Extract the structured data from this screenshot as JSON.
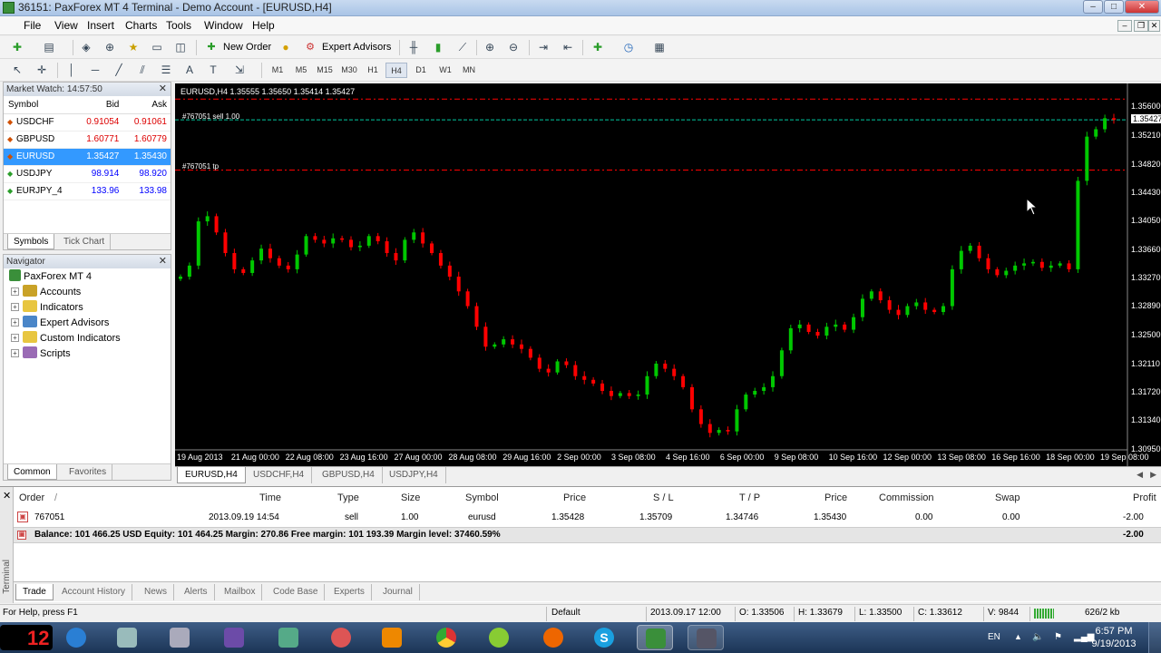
{
  "window": {
    "title": "36151: PaxForex MT 4 Terminal - Demo Account - [EURUSD,H4]"
  },
  "menu": [
    "File",
    "View",
    "Insert",
    "Charts",
    "Tools",
    "Window",
    "Help"
  ],
  "toolbar": {
    "new_order": "New Order",
    "expert_advisors": "Expert Advisors",
    "timeframes": [
      "M1",
      "M5",
      "M15",
      "M30",
      "H1",
      "H4",
      "D1",
      "W1",
      "MN"
    ],
    "active_timeframe": "H4"
  },
  "market_watch": {
    "title": "Market Watch: 14:57:50",
    "columns": [
      "Symbol",
      "Bid",
      "Ask"
    ],
    "rows": [
      {
        "symbol": "USDCHF",
        "bid": "0.91054",
        "ask": "0.91061",
        "dir": "down"
      },
      {
        "symbol": "GBPUSD",
        "bid": "1.60771",
        "ask": "1.60779",
        "dir": "down"
      },
      {
        "symbol": "EURUSD",
        "bid": "1.35427",
        "ask": "1.35430",
        "dir": "down",
        "selected": true
      },
      {
        "symbol": "USDJPY",
        "bid": "98.914",
        "ask": "98.920",
        "dir": "up"
      },
      {
        "symbol": "EURJPY_4",
        "bid": "133.96",
        "ask": "133.98",
        "dir": "up"
      }
    ],
    "tabs": [
      "Symbols",
      "Tick Chart"
    ]
  },
  "navigator": {
    "title": "Navigator",
    "root": "PaxForex MT 4",
    "items": [
      "Accounts",
      "Indicators",
      "Expert Advisors",
      "Custom Indicators",
      "Scripts"
    ],
    "tabs": [
      "Common",
      "Favorites"
    ]
  },
  "chart": {
    "info": "EURUSD,H4  1.35555 1.35650 1.35414 1.35427",
    "order_sell_label": "#767051 sell 1.00",
    "order_tp_label": "#767051 tp",
    "current_price": "1.35427",
    "cursor_icon": "arrow-cursor-icon",
    "tabs": [
      "EURUSD,H4",
      "USDCHF,H4",
      "GBPUSD,H4",
      "USDJPY,H4"
    ],
    "active_tab": "EURUSD,H4"
  },
  "chart_data": {
    "type": "candlestick",
    "symbol": "EURUSD",
    "timeframe": "H4",
    "ylim": [
      1.3095,
      1.357
    ],
    "y_ticks": [
      "1.35600",
      "1.35427",
      "1.35210",
      "1.34820",
      "1.34430",
      "1.34050",
      "1.33660",
      "1.33270",
      "1.32890",
      "1.32500",
      "1.32110",
      "1.31720",
      "1.31340",
      "1.30950"
    ],
    "x_ticks": [
      "19 Aug 2013",
      "21 Aug 00:00",
      "22 Aug 08:00",
      "23 Aug 16:00",
      "27 Aug 00:00",
      "28 Aug 08:00",
      "29 Aug 16:00",
      "2 Sep 00:00",
      "3 Sep 08:00",
      "4 Sep 16:00",
      "6 Sep 00:00",
      "9 Sep 08:00",
      "10 Sep 16:00",
      "12 Sep 00:00",
      "13 Sep 08:00",
      "16 Sep 16:00",
      "18 Sep 00:00",
      "19 Sep 08:00"
    ],
    "close_path": [
      1.333,
      1.3345,
      1.3405,
      1.3412,
      1.339,
      1.3362,
      1.334,
      1.3335,
      1.3352,
      1.3368,
      1.3355,
      1.3345,
      1.334,
      1.336,
      1.3385,
      1.338,
      1.3375,
      1.3382,
      1.338,
      1.337,
      1.3372,
      1.3385,
      1.3378,
      1.3362,
      1.3352,
      1.338,
      1.339,
      1.3375,
      1.3362,
      1.3345,
      1.333,
      1.331,
      1.329,
      1.3262,
      1.3235,
      1.3238,
      1.3245,
      1.3238,
      1.3232,
      1.322,
      1.3205,
      1.32,
      1.3215,
      1.321,
      1.3195,
      1.319,
      1.3185,
      1.3175,
      1.3168,
      1.3172,
      1.3168,
      1.317,
      1.3195,
      1.3212,
      1.3205,
      1.3195,
      1.318,
      1.315,
      1.313,
      1.3118,
      1.3122,
      1.312,
      1.315,
      1.317,
      1.3175,
      1.318,
      1.3195,
      1.323,
      1.326,
      1.3265,
      1.3255,
      1.325,
      1.3262,
      1.3265,
      1.3258,
      1.3275,
      1.33,
      1.331,
      1.3298,
      1.3285,
      1.3278,
      1.329,
      1.3295,
      1.3285,
      1.3282,
      1.329,
      1.334,
      1.3365,
      1.3372,
      1.3355,
      1.334,
      1.3332,
      1.3338,
      1.3345,
      1.3348,
      1.335,
      1.3342,
      1.3345,
      1.3348,
      1.334,
      1.346,
      1.352,
      1.353,
      1.3545,
      1.3543
    ],
    "open_order": {
      "id": "767051",
      "type": "sell",
      "price": 1.35428,
      "sl": 1.35709,
      "tp": 1.34746
    }
  },
  "terminal": {
    "side_label": "Terminal",
    "columns": [
      "Order",
      "/",
      "Time",
      "Type",
      "Size",
      "Symbol",
      "Price",
      "S / L",
      "T / P",
      "Price",
      "Commission",
      "Swap",
      "Profit"
    ],
    "order": {
      "order": "767051",
      "time": "2013.09.19 14:54",
      "type": "sell",
      "size": "1.00",
      "symbol": "eurusd",
      "price": "1.35428",
      "sl": "1.35709",
      "tp": "1.34746",
      "price_current": "1.35430",
      "commission": "0.00",
      "swap": "0.00",
      "profit": "-2.00"
    },
    "balance_line": "Balance: 101 466.25 USD  Equity: 101 464.25  Margin: 270.86  Free margin: 101 193.39  Margin level: 37460.59%",
    "balance_profit": "-2.00",
    "tabs": [
      "Trade",
      "Account History",
      "News",
      "Alerts",
      "Mailbox",
      "Code Base",
      "Experts",
      "Journal"
    ],
    "active_tab": "Trade"
  },
  "statusbar": {
    "help": "For Help, press F1",
    "profile": "Default",
    "datetime": "2013.09.17 12:00",
    "open": "O: 1.33506",
    "high": "H: 1.33679",
    "low": "L: 1.33500",
    "close": "C: 1.33612",
    "volume": "V: 9844",
    "traffic": "626/2 kb"
  },
  "taskbar": {
    "lang": "EN",
    "time": "6:57 PM",
    "date": "9/19/2013",
    "badge": "12"
  },
  "colors": {
    "bull": "#00c800",
    "bear": "#ff0000",
    "chart_bg": "#000000",
    "selection": "#3399ff",
    "sl_line": "#ff0000",
    "entry_line": "#00c8a0"
  }
}
